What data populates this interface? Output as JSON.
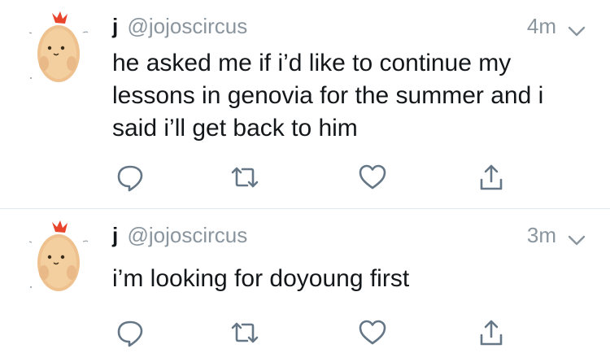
{
  "tweets": [
    {
      "display_name": "j",
      "handle": "@jojoscircus",
      "time": "4m",
      "text": "he asked me if i’d like to continue my lessons in genovia for the summer and i said i’ll get back to him",
      "avatar_icon": "shrimp-plush-avatar",
      "actions": [
        "reply-icon",
        "retweet-icon",
        "like-icon",
        "share-icon"
      ]
    },
    {
      "display_name": "j",
      "handle": "@jojoscircus",
      "time": "3m",
      "text": "i’m looking for doyoung first",
      "avatar_icon": "shrimp-plush-avatar",
      "actions": [
        "reply-icon",
        "retweet-icon",
        "like-icon",
        "share-icon"
      ]
    }
  ],
  "colors": {
    "text": "#14171a",
    "secondary": "#8a959e",
    "icon": "#657786",
    "divider": "#e1e8ed"
  }
}
